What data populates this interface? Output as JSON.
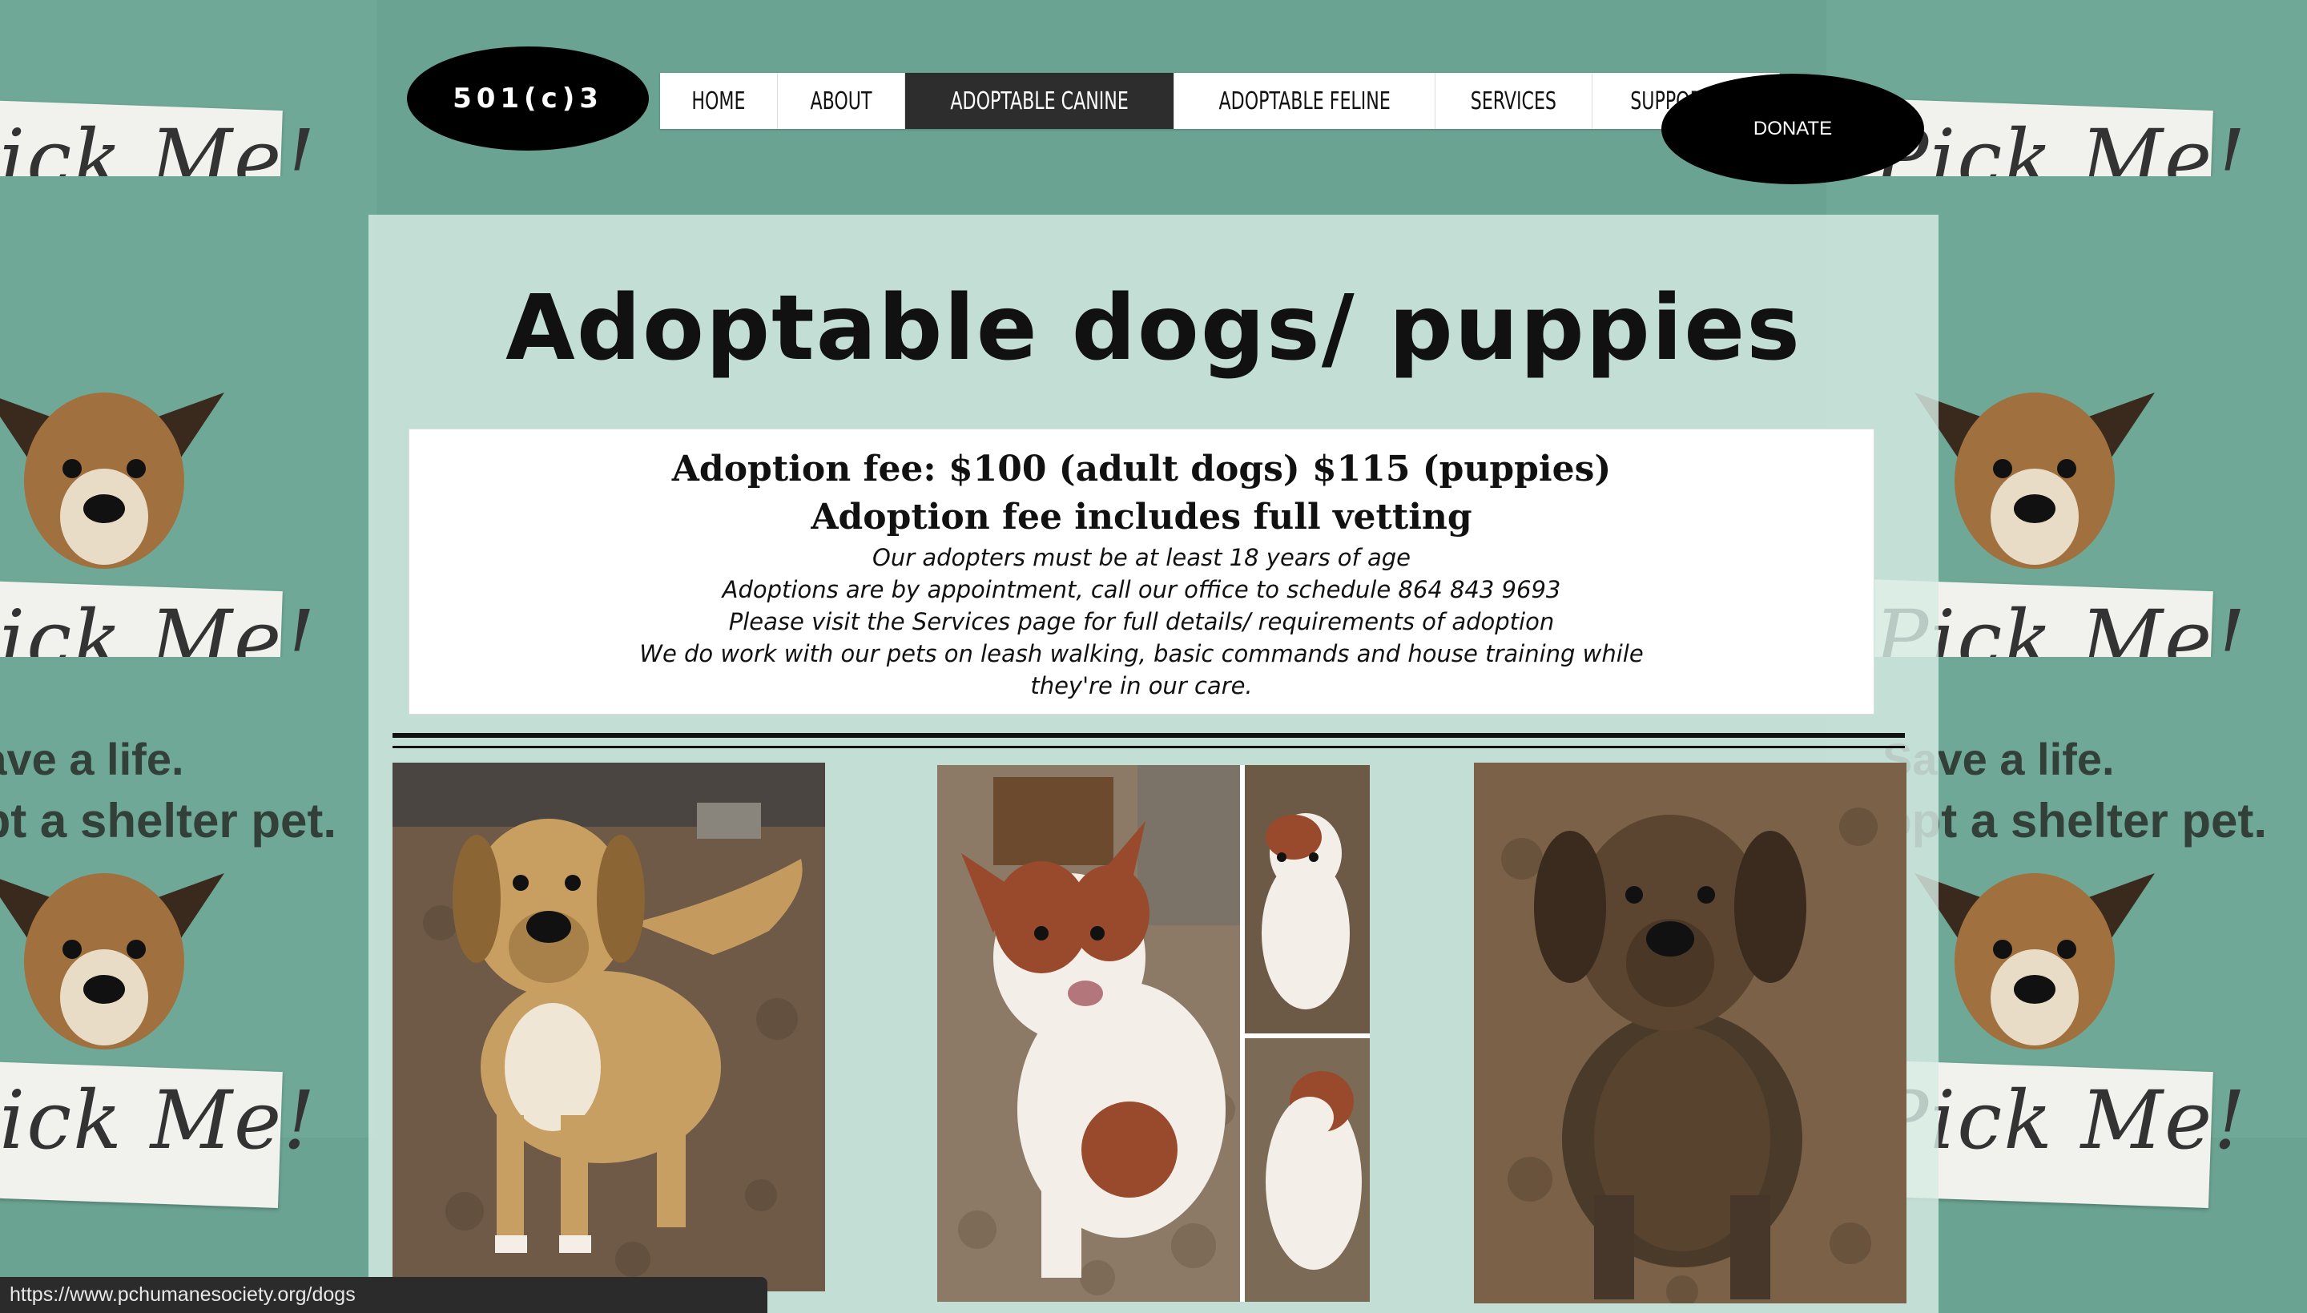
{
  "brand": {
    "badge": "501(c)3"
  },
  "nav": {
    "items": [
      {
        "label": "HOME"
      },
      {
        "label": "ABOUT"
      },
      {
        "label": "ADOPTABLE CANINE"
      },
      {
        "label": "ADOPTABLE FELINE"
      },
      {
        "label": "SERVICES"
      },
      {
        "label": "SUPPORT US"
      }
    ],
    "active": "ADOPTABLE CANINE",
    "donate_label": "DONATE"
  },
  "background": {
    "slogan_line1": "Save a life.",
    "slogan_line2": "Adopt a shelter pet.",
    "sign_text": "Pick Me!"
  },
  "main": {
    "title": "Adoptable dogs/ puppies",
    "fee_line1": "Adoption fee: $100 (adult dogs) $115 (puppies)",
    "fee_line2": "Adoption fee includes full vetting",
    "note1": "Our adopters must be at least 18 years of age",
    "note2": "Adoptions are by appointment, call our office to schedule 864 843 9693",
    "note3": "Please visit the Services page for full details/ requirements of adoption",
    "note4": "We do work with our pets on leash walking, basic commands and house training while they're in our care."
  },
  "status_url": "https://www.pchumanesociety.org/dogs",
  "colors": {
    "bg_green": "#6fa897",
    "panel": "#d7ebe4",
    "nav_active": "#2d2d2d",
    "black": "#000000"
  }
}
